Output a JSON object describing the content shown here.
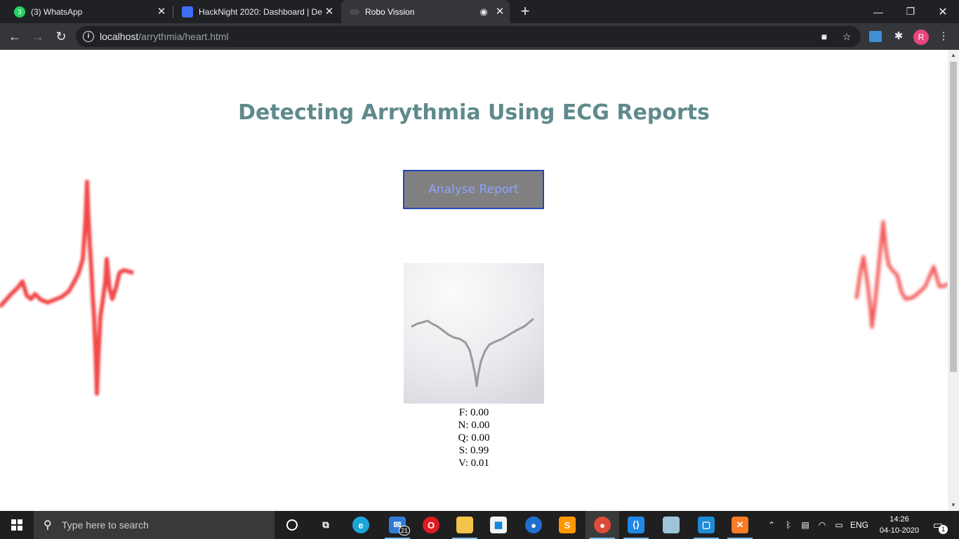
{
  "browser": {
    "tabs": [
      {
        "title": "(3) WhatsApp",
        "badge": "3",
        "active": false
      },
      {
        "title": "HackNight 2020: Dashboard | De",
        "active": false
      },
      {
        "title": "Robo Vission",
        "active": true
      }
    ],
    "new_tab_symbol": "+",
    "address": {
      "host": "localhost",
      "path": "/arrythmia/heart.html"
    },
    "profile_initial": "R"
  },
  "page": {
    "title": "Detecting Arrythmia Using ECG Reports",
    "analyse_button": "Analyse Report",
    "results": [
      {
        "label": "F: 0.00"
      },
      {
        "label": "N: 0.00"
      },
      {
        "label": "Q: 0.00"
      },
      {
        "label": "S: 0.99"
      },
      {
        "label": "V: 0.01"
      }
    ]
  },
  "taskbar": {
    "search_placeholder": "Type here to search",
    "mail_badge": "21",
    "language": "ENG",
    "time": "14:26",
    "date": "04-10-2020",
    "notification_count": "1"
  },
  "colors": {
    "title": "#5f8a8b",
    "button_bg": "#808080",
    "button_border": "#2447b8",
    "button_text": "#8fa3ff",
    "ecg_trace": "#f24a4a"
  },
  "icons": [
    "whatsapp-icon",
    "docs-icon",
    "robo-icon",
    "back-icon",
    "forward-icon",
    "reload-icon",
    "info-icon",
    "camera-icon",
    "star-icon",
    "extension-icon",
    "puzzle-icon",
    "menu-icon",
    "windows-icon",
    "search-icon"
  ]
}
